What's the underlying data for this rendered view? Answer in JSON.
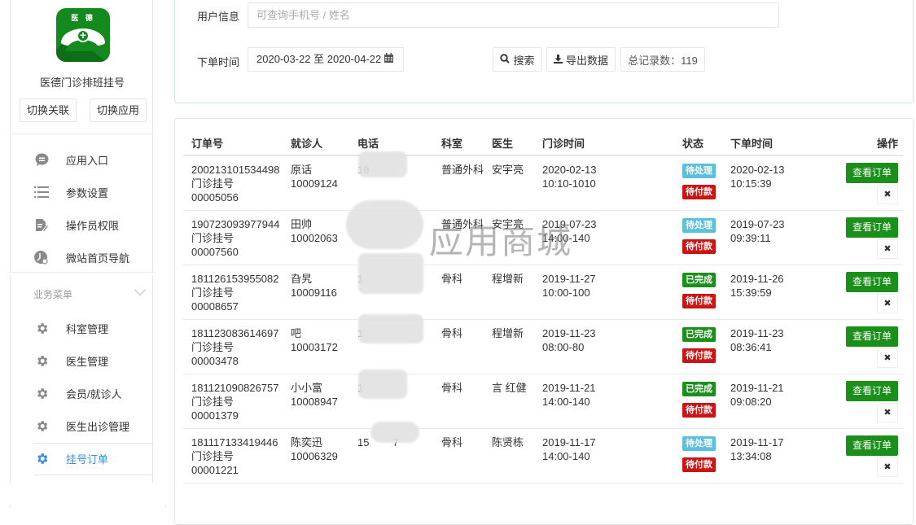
{
  "app": {
    "name": "医德门诊排班挂号",
    "logo_text": "医 德",
    "switch_link_label": "切换关联",
    "switch_app_label": "切换应用"
  },
  "sidebar": {
    "top_items": [
      {
        "label": "应用入口",
        "icon": "chat-bubble-icon"
      },
      {
        "label": "参数设置",
        "icon": "list-icon"
      },
      {
        "label": "操作员权限",
        "icon": "document-edit-icon"
      },
      {
        "label": "微站首页导航",
        "icon": "clock-icon"
      }
    ],
    "group_title": "业务菜单",
    "group_items": [
      {
        "label": "科室管理",
        "icon": "gear-icon",
        "active": false
      },
      {
        "label": "医生管理",
        "icon": "gear-icon",
        "active": false
      },
      {
        "label": "会员/就诊人",
        "icon": "gear-icon",
        "active": false
      },
      {
        "label": "医生出诊管理",
        "icon": "gear-icon",
        "active": false
      },
      {
        "label": "挂号订单",
        "icon": "gear-icon",
        "active": true
      }
    ]
  },
  "filter": {
    "user_info_label": "用户信息",
    "user_info_placeholder": "可查询手机号 / 姓名",
    "user_info_value": "",
    "order_time_label": "下单时间",
    "date_range": "2020-03-22 至 2020-04-22",
    "search_label": "搜索",
    "export_label": "导出数据",
    "total_label": "总记录数：119"
  },
  "table": {
    "headers": [
      "订单号",
      "就诊人",
      "电话",
      "科室",
      "医生",
      "门诊时间",
      "状态",
      "下单时间",
      "操作"
    ],
    "view_label": "查看订单",
    "delete_glyph": "✖",
    "rows": [
      {
        "order_no": "200213101534498",
        "order_type": "门诊挂号",
        "order_seq": "00005056",
        "patient": "原话",
        "patient_id": "10009124",
        "phone": "18",
        "dept": "普通外科",
        "doctor": "安宇亮",
        "visit_date": "2020-02-13",
        "visit_time": "10:10-1010",
        "status": "待处理",
        "status_color": "#5bc0de",
        "pay_status": "待付款",
        "order_date": "2020-02-13",
        "order_time": "10:15:39"
      },
      {
        "order_no": "190723093977944",
        "order_type": "门诊挂号",
        "order_seq": "00007560",
        "patient": "田帅",
        "patient_id": "10002063",
        "phone": "",
        "dept": "普通外科",
        "doctor": "安宇亮",
        "visit_date": "2019-07-23",
        "visit_time": "14:00-140",
        "status": "待处理",
        "status_color": "#5bc0de",
        "pay_status": "待付款",
        "order_date": "2019-07-23",
        "order_time": "09:39:11"
      },
      {
        "order_no": "181126153955082",
        "order_type": "门诊挂号",
        "order_seq": "00008657",
        "patient": "旮旯",
        "patient_id": "10009116",
        "phone": "1",
        "dept": "骨科",
        "doctor": "程增新",
        "visit_date": "2019-11-27",
        "visit_time": "10:00-100",
        "status": "已完成",
        "status_color": "#1a8f1a",
        "pay_status": "待付款",
        "order_date": "2019-11-26",
        "order_time": "15:39:59"
      },
      {
        "order_no": "181123083614697",
        "order_type": "门诊挂号",
        "order_seq": "00003478",
        "patient": "吧",
        "patient_id": "10003172",
        "phone": "1",
        "dept": "骨科",
        "doctor": "程增新",
        "visit_date": "2019-11-23",
        "visit_time": "08:00-80",
        "status": "已完成",
        "status_color": "#1a8f1a",
        "pay_status": "待付款",
        "order_date": "2019-11-23",
        "order_time": "08:36:41"
      },
      {
        "order_no": "181121090826757",
        "order_type": "门诊挂号",
        "order_seq": "00001379",
        "patient": "小小富",
        "patient_id": "10008947",
        "phone": "1",
        "dept": "骨科",
        "doctor": "言 红健",
        "visit_date": "2019-11-21",
        "visit_time": "14:00-140",
        "status": "已完成",
        "status_color": "#1a8f1a",
        "pay_status": "待付款",
        "order_date": "2019-11-21",
        "order_time": "09:08:20"
      },
      {
        "order_no": "181117133419446",
        "order_type": "门诊挂号",
        "order_seq": "00001221",
        "patient": "陈奕迅",
        "patient_id": "10006329",
        "phone": "15        7",
        "dept": "骨科",
        "doctor": "陈贤栋",
        "visit_date": "2019-11-17",
        "visit_time": "14:00-140",
        "status": "待处理",
        "status_color": "#5bc0de",
        "pay_status": "待付款",
        "order_date": "2019-11-17",
        "order_time": "13:34:08"
      }
    ]
  },
  "colors": {
    "pay_badge": "#cc1414",
    "view_button": "#1a8f1a",
    "active_menu": "#3a8ee6",
    "logo": "#148a1e"
  },
  "watermark": "应用商城"
}
